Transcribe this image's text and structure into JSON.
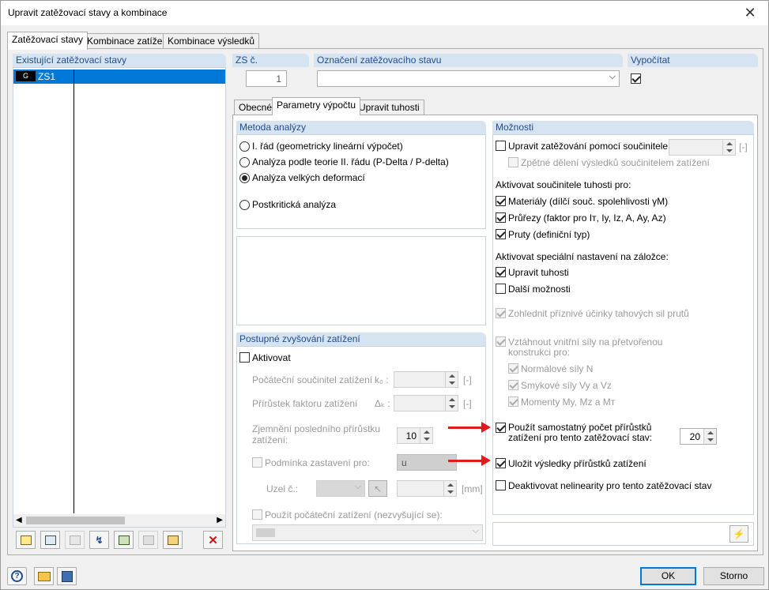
{
  "window": {
    "title": "Upravit zatěžovací stavy a kombinace",
    "close_glyph": "✕"
  },
  "top_tabs": [
    {
      "label": "Zatěžovací stavy",
      "active": true
    },
    {
      "label": "Kombinace zatížení",
      "active": false
    },
    {
      "label": "Kombinace výsledků",
      "active": false
    }
  ],
  "left_list": {
    "header": "Existující zatěžovací stavy",
    "items": [
      {
        "tag": "G",
        "name": "ZS1",
        "selected": true
      }
    ]
  },
  "zs_number": {
    "header": "ZS č.",
    "value": "1"
  },
  "designation": {
    "header": "Označení zatěžovacího stavu",
    "value": ""
  },
  "calculate": {
    "header": "Vypočítat",
    "checked": true
  },
  "sub_tabs": [
    {
      "label": "Obecné",
      "active": false
    },
    {
      "label": "Parametry výpočtu",
      "active": true
    },
    {
      "label": "Upravit tuhosti",
      "active": false
    }
  ],
  "analysis_method": {
    "header": "Metoda analýzy",
    "options": [
      {
        "label": "I. řád (geometricky lineární výpočet)",
        "selected": false
      },
      {
        "label": "Analýza podle teorie II. řádu (P-Delta / P-delta)",
        "selected": false
      },
      {
        "label": "Analýza velkých deformací",
        "selected": true
      },
      {
        "label": "Postkritická analýza",
        "selected": false
      }
    ]
  },
  "incremental": {
    "header": "Postupné zvyšování zatížení",
    "activate_label": "Aktivovat",
    "initial_factor_label": "Počáteční součinitel zatížení",
    "initial_factor_symbol": "k₀ :",
    "increment_label": "Přírůstek faktoru zatížení",
    "increment_symbol": "Δₖ :",
    "unit": "[-]",
    "refine_label_1": "Zjemnění posledního přírůstku",
    "refine_label_2": "zatížení:",
    "refine_value": "10",
    "stop_condition_label": "Podmínka zastavení pro:",
    "stop_condition_value": "u",
    "node_label": "Uzel č.:",
    "mm_unit": "[mm]",
    "initial_load_label": "Použít počáteční zatížení (nezvyšující se):"
  },
  "options": {
    "header": "Možnosti",
    "modify_load_label": "Upravit zatěžování pomocí součinitele:",
    "unit": "[-]",
    "back_divide_label": "Zpětné dělení výsledků součinitelem zatížení",
    "stiffness_header": "Aktivovat součinitele tuhosti pro:",
    "materials_label": "Materiály (dílčí souč. spolehlivosti γM)",
    "sections_label": "Průřezy (faktor pro Iᴛ, Iy, Iz, A, Ay, Az)",
    "members_label": "Pruty (definiční typ)",
    "special_header": "Aktivovat speciální nastavení na záložce:",
    "modify_stiffness_label": "Upravit tuhosti",
    "further_options_label": "Další možnosti",
    "tension_label": "Zohlednit příznivé účinky tahových sil prutů",
    "refer_forces_label_1": "Vztáhnout vnitřní síly na přetvořenou",
    "refer_forces_label_2": "konstrukci pro:",
    "normal_forces_label": "Normálové síly N",
    "shear_forces_label": "Smykové síly Vy a Vz",
    "moments_label": "Momenty My, Mz a Mᴛ",
    "own_increments_label_1": "Použít samostatný počet přírůstků",
    "own_increments_label_2": "zatížení pro tento zatěžovací stav:",
    "own_increments_value": "20",
    "save_results_label": "Uložit výsledky přírůstků zatížení",
    "deactivate_nonlinear_label": "Deaktivovat nelinearity pro tento zatěžovací stav"
  },
  "buttons": {
    "ok": "OK",
    "cancel": "Storno"
  },
  "colors": {
    "accent": "#0078d7",
    "group_header": "#d6e4f2",
    "arrow": "#e01b1b"
  }
}
